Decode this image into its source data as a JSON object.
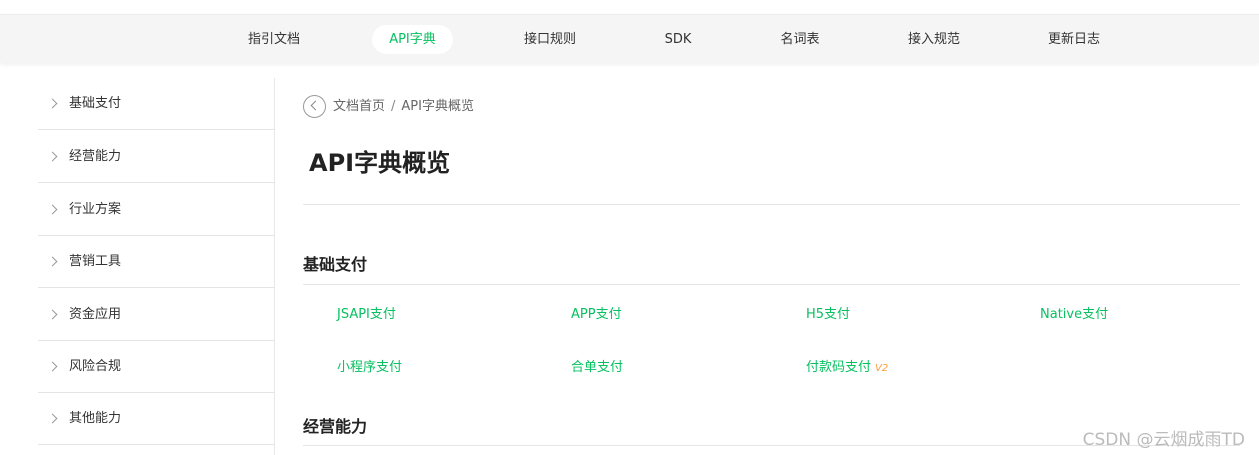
{
  "nav": {
    "items": [
      {
        "label": "指引文档",
        "active": false
      },
      {
        "label": "API字典",
        "active": true
      },
      {
        "label": "接口规则",
        "active": false
      },
      {
        "label": "SDK",
        "active": false
      },
      {
        "label": "名词表",
        "active": false
      },
      {
        "label": "接入规范",
        "active": false
      },
      {
        "label": "更新日志",
        "active": false
      }
    ]
  },
  "sidebar": {
    "items": [
      {
        "label": "基础支付"
      },
      {
        "label": "经营能力"
      },
      {
        "label": "行业方案"
      },
      {
        "label": "营销工具"
      },
      {
        "label": "资金应用"
      },
      {
        "label": "风险合规"
      },
      {
        "label": "其他能力"
      }
    ]
  },
  "breadcrumb": {
    "home": "文档首页",
    "separator": "/",
    "current": "API字典概览"
  },
  "page": {
    "title": "API字典概览"
  },
  "sections": [
    {
      "title": "基础支付",
      "links": [
        {
          "label": "JSAPI支付",
          "badge": ""
        },
        {
          "label": "APP支付",
          "badge": ""
        },
        {
          "label": "H5支付",
          "badge": ""
        },
        {
          "label": "Native支付",
          "badge": ""
        },
        {
          "label": "小程序支付",
          "badge": ""
        },
        {
          "label": "合单支付",
          "badge": ""
        },
        {
          "label": "付款码支付",
          "badge": "V2"
        }
      ]
    },
    {
      "title": "经营能力",
      "links": []
    }
  ],
  "watermark": "CSDN @云烟成雨TD",
  "colors": {
    "accent": "#07c160",
    "badge": "#fa9d3b",
    "nav_background": "#f5f5f5"
  },
  "icons": {
    "back": "back-circle-icon",
    "sidebar_chevron": "chevron-right-icon"
  }
}
